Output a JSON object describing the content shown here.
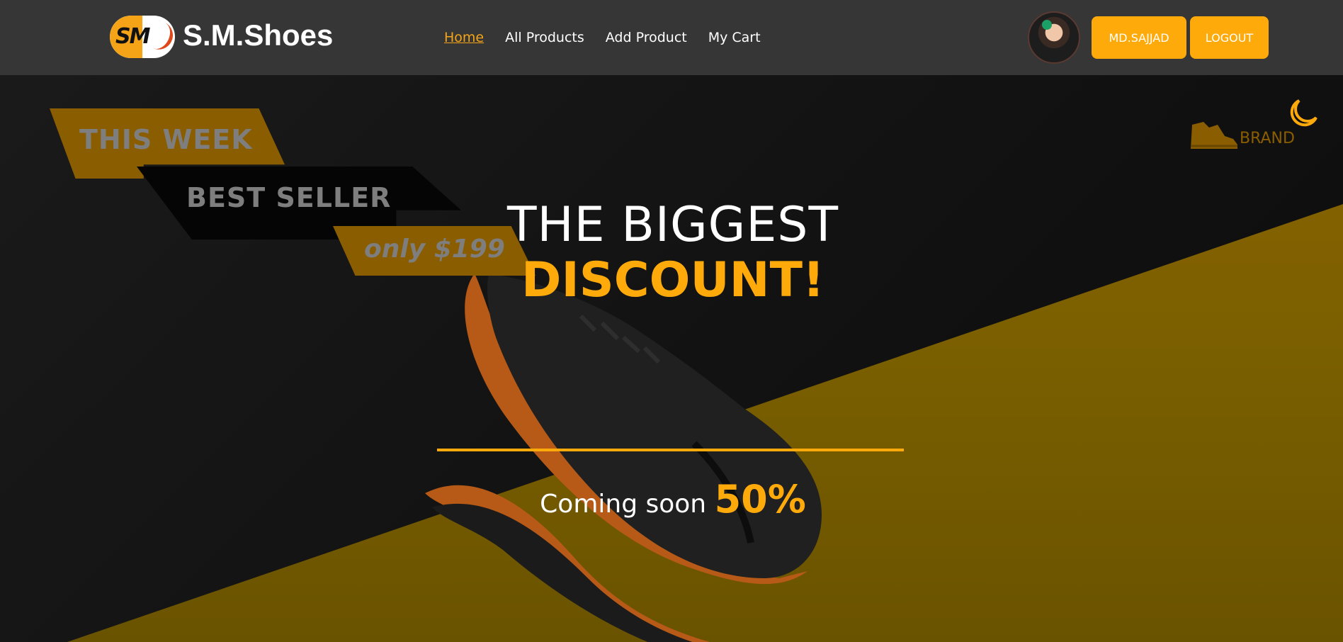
{
  "brand": {
    "logo_monogram": "SM",
    "name": "S.M.Shoes"
  },
  "nav": {
    "links": [
      "Home",
      "All Products",
      "Add Product",
      "My Cart"
    ],
    "active": "Home"
  },
  "user": {
    "name_button": "MD.SAJJAD",
    "logout_button": "LOGOUT"
  },
  "hero": {
    "tags": {
      "week": "THIS WEEK",
      "best": "BEST SELLER",
      "price": "only $199"
    },
    "headline_line1": "THE BIGGEST",
    "headline_line2": "DISCOUNT!",
    "coming_text": "Coming soon",
    "discount_percent": "50%",
    "brand_label": "BRAND"
  },
  "colors": {
    "accent": "#feaa0b",
    "navbar": "#363636",
    "tag_brown": "#8a5d00",
    "hero_dark": "#141414"
  },
  "icons": [
    "moon-icon",
    "shoe-icon"
  ]
}
